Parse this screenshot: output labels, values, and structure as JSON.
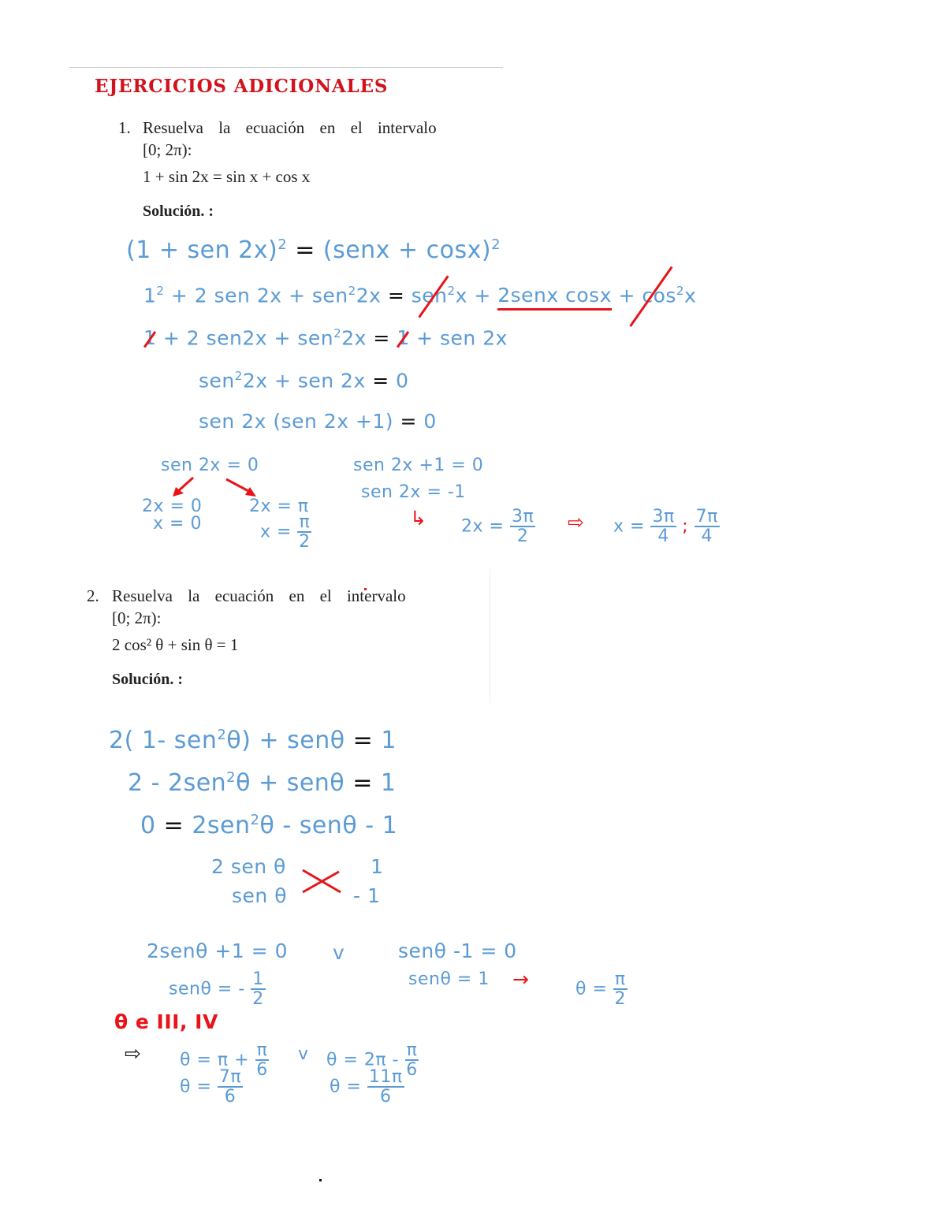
{
  "section_title": "EJERCICIOS ADICIONALES",
  "exercises": [
    {
      "number": "1.",
      "prompt_line1": "Resuelva la ecuación en el intervalo",
      "prompt_line2": "[0; 2π):",
      "equation": "1 + sin 2x = sin x + cos x",
      "solution_label": "Solución. :",
      "handwritten": {
        "step1_left": "(1 + sen 2x)",
        "step1_exp": "2",
        "step1_eq": "=",
        "step1_right": "(senx + cosx)",
        "step1_right_exp": "2",
        "step2_a": "1",
        "step2_a_exp": "2",
        "step2_b": "+ 2 sen 2x + sen",
        "step2_b_exp": "2",
        "step2_c": "2x",
        "step2_eq": "=",
        "step2_d": "sen",
        "step2_d_exp": "2",
        "step2_e": "x +",
        "step2_f": "2senx cosx",
        "step2_g": "+ cos",
        "step2_g_exp": "2",
        "step2_h": "x",
        "step3_a": "1",
        "step3_b": "+ 2 sen2x + sen",
        "step3_b_exp": "2",
        "step3_c": "2x",
        "step3_eq": "=",
        "step3_d": "1",
        "step3_e": "+ sen 2x",
        "step4_a": "sen",
        "step4_a_exp": "2",
        "step4_b": "2x + sen 2x",
        "step4_eq": "=",
        "step4_c": "0",
        "step5_a": "sen 2x (sen 2x +1)",
        "step5_eq": "=",
        "step5_c": "0",
        "case1_head": "sen 2x = 0",
        "case1_left_1": "2x = 0",
        "case1_left_2": "x = 0",
        "case1_right_1": "2x = π",
        "case1_right_2_lhs": "x =",
        "case1_right_2_num": "π",
        "case1_right_2_den": "2",
        "case2_head": "sen 2x +1 = 0",
        "case2_line2": "sen 2x = -1",
        "case2_arrow": "↳",
        "case2_line3_lhs": "2x =",
        "case2_line3_num": "3π",
        "case2_line3_den": "2",
        "case2_implies": "⇨",
        "case2_result_lhs": "x =",
        "case2_result1_num": "3π",
        "case2_result1_den": "4",
        "case2_sep": ";",
        "case2_result2_num": "7π",
        "case2_result2_den": "4"
      }
    },
    {
      "number": "2.",
      "prompt_line1": "Resuelva la ecuación en el intervalo",
      "prompt_line2": "[0; 2π):",
      "equation": "2 cos² θ + sin θ = 1",
      "solution_label": "Solución. :",
      "handwritten": {
        "step1_a": "2( 1- sen",
        "step1_exp": "2",
        "step1_b": "θ) + senθ",
        "step1_eq": "=",
        "step1_c": "1",
        "step2_a": "2 - 2sen",
        "step2_exp": "2",
        "step2_b": "θ + senθ",
        "step2_eq": "=",
        "step2_c": "1",
        "step3_a": "0",
        "step3_eq": "=",
        "step3_b": "2sen",
        "step3_exp": "2",
        "step3_c": "θ - senθ - 1",
        "factor_l1": "2 sen θ",
        "factor_l2": "sen θ",
        "factor_cross": "✕",
        "factor_r1": "1",
        "factor_r2": "- 1",
        "caseA_1": "2senθ +1 = 0",
        "or_symbol": "v",
        "caseB_1": "senθ -1 = 0",
        "caseA_2_lhs": "senθ = -",
        "caseA_2_num": "1",
        "caseA_2_den": "2",
        "caseB_2": "senθ = 1",
        "caseB_arrow": "→",
        "caseB_3_lhs": "θ =",
        "caseB_3_num": "π",
        "caseB_3_den": "2",
        "quadrant_note": "θ e III, IV",
        "implies": "⇨",
        "sol1_lhs": "θ = π +",
        "sol1_num": "π",
        "sol1_den": "6",
        "sol_or": "v",
        "sol2_lhs": "θ = 2π -",
        "sol2_num": "π",
        "sol2_den": "6",
        "res1_lhs": "θ =",
        "res1_num": "7π",
        "res1_den": "6",
        "res2_lhs": "θ =",
        "res2_num": "11π",
        "res2_den": "6"
      }
    }
  ],
  "colors": {
    "title_red": "#d0131c",
    "ink_blue": "#5b9bd5",
    "ink_red": "#e8141a",
    "ink_black": "#111111"
  }
}
